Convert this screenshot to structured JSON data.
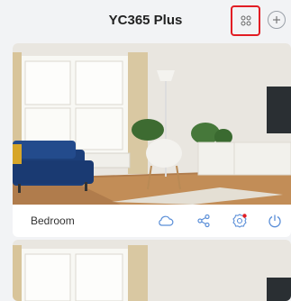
{
  "header": {
    "title": "YC365 Plus",
    "grid_icon": "grid-view-icon",
    "add_icon": "plus-icon",
    "highlight_color": "#e21d24"
  },
  "cameras": [
    {
      "name": "Bedroom",
      "actions": [
        "cloud-icon",
        "share-icon",
        "settings-icon",
        "power-icon"
      ],
      "settings_badge_color": "#e21d24",
      "accent_color": "#5b8fd8"
    },
    {
      "name": ""
    }
  ]
}
